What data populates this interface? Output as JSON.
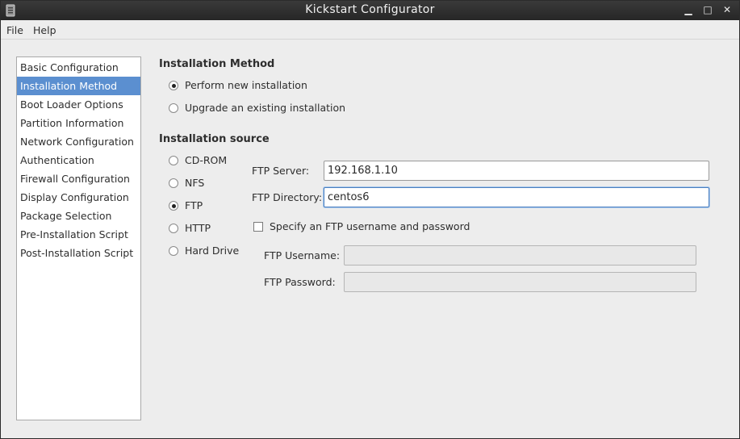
{
  "window": {
    "title": "Kickstart Configurator",
    "controls": {
      "minimize": "▁",
      "maximize": "□",
      "close": "✕"
    }
  },
  "menu": {
    "file": "File",
    "help": "Help"
  },
  "sidebar": {
    "items": [
      {
        "label": "Basic Configuration"
      },
      {
        "label": "Installation Method",
        "selected": true
      },
      {
        "label": "Boot Loader Options"
      },
      {
        "label": "Partition Information"
      },
      {
        "label": "Network Configuration"
      },
      {
        "label": "Authentication"
      },
      {
        "label": "Firewall Configuration"
      },
      {
        "label": "Display Configuration"
      },
      {
        "label": "Package Selection"
      },
      {
        "label": "Pre-Installation Script"
      },
      {
        "label": "Post-Installation Script"
      }
    ]
  },
  "installation_method": {
    "heading": "Installation Method",
    "options": [
      {
        "label": "Perform new installation",
        "checked": true
      },
      {
        "label": "Upgrade an existing installation",
        "checked": false
      }
    ]
  },
  "installation_source": {
    "heading": "Installation source",
    "options": [
      {
        "label": "CD-ROM",
        "checked": false
      },
      {
        "label": "NFS",
        "checked": false
      },
      {
        "label": "FTP",
        "checked": true
      },
      {
        "label": "HTTP",
        "checked": false
      },
      {
        "label": "Hard Drive",
        "checked": false
      }
    ]
  },
  "ftp": {
    "server_label": "FTP Server:",
    "server_value": "192.168.1.10",
    "directory_label": "FTP Directory:",
    "directory_value": "centos6",
    "credentials_checkbox_label": "Specify an FTP username and password",
    "username_label": "FTP Username:",
    "username_value": "",
    "password_label": "FTP Password:",
    "password_value": ""
  },
  "colors": {
    "selection": "#5b8fd0",
    "titlebar": "#2b2b2b",
    "background": "#ededed"
  }
}
